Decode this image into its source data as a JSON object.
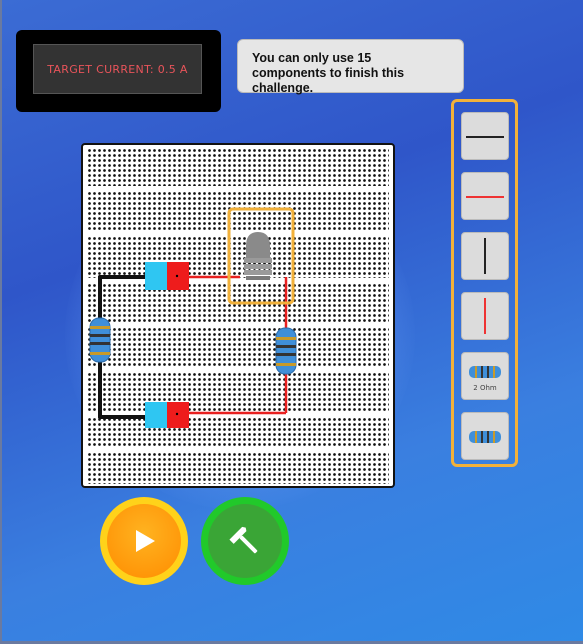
{
  "hud": {
    "target_current": "TARGET CURRENT: 0.5 A",
    "message": "You can only use 15 components to finish this challenge."
  },
  "palette": {
    "items": [
      {
        "name": "black-wire"
      },
      {
        "name": "red-wire"
      },
      {
        "name": "black-wire-vertical"
      },
      {
        "name": "red-wire-vertical"
      },
      {
        "name": "resistor-2-ohm",
        "label": "2 Ohm"
      },
      {
        "name": "resistor"
      }
    ]
  },
  "circuit": {
    "components": [
      "battery-top",
      "battery-bottom",
      "bulb",
      "resistor-left",
      "resistor-right"
    ]
  },
  "controls": {
    "play": "play-icon",
    "build": "hammer-icon"
  },
  "colors": {
    "highlight": "#f2b13a",
    "wire_red": "#e82020",
    "wire_black": "#111111",
    "battery_neg": "#2fc6f2",
    "battery_pos": "#ee1c1c",
    "play": "#ff9a0a",
    "build": "#3aa536"
  }
}
